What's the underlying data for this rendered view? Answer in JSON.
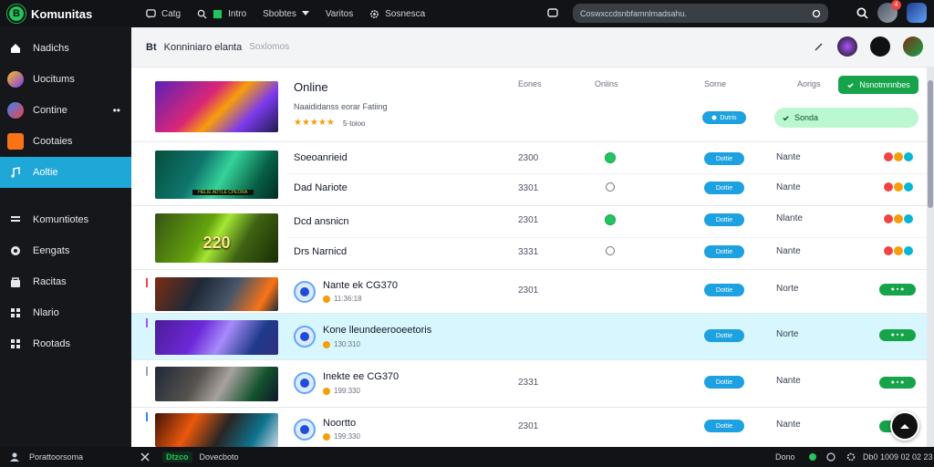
{
  "app": {
    "name": "Komunitas",
    "logo_letter": "B"
  },
  "topnav": [
    {
      "label": "Catg",
      "icon": "chat-icon"
    },
    {
      "label": "Intro",
      "icon": "flag-icon"
    },
    {
      "label": "Sbobtes",
      "icon": "menu-icon"
    },
    {
      "label": "Varitos",
      "icon": "chevron-down-icon"
    },
    {
      "label": "Sosnesca",
      "icon": "settings-icon"
    }
  ],
  "search": {
    "value": "Coswxccdsnbfamnlmadsahu."
  },
  "user": {
    "notification_count": "4"
  },
  "sidebar": {
    "items": [
      {
        "label": "Nadichs",
        "icon": "home-icon"
      },
      {
        "label": "Uocitums",
        "icon": "user-avatar-icon"
      },
      {
        "label": "Contine",
        "icon": "globe-icon",
        "more": "••"
      },
      {
        "label": "Cootaies",
        "icon": "flag-icon"
      },
      {
        "label": "Aoltie",
        "icon": "music-note-icon",
        "active": true
      }
    ],
    "items2": [
      {
        "label": "Komuntiotes",
        "icon": "list-icon"
      },
      {
        "label": "Eengats",
        "icon": "chat-icon"
      },
      {
        "label": "Racitas",
        "icon": "lock-icon"
      },
      {
        "label": "Nlario",
        "icon": "grid-icon"
      },
      {
        "label": "Rootads",
        "icon": "grid-icon"
      }
    ],
    "footer": "Porattoorsoma"
  },
  "main": {
    "header": {
      "title": "Bt",
      "subtitle": "Konniniaro elanta",
      "tail": "Soxlomos"
    },
    "columns": {
      "a": "Eones",
      "b": "Onlins",
      "c": "Sorne",
      "d": "Aorigs"
    },
    "featured": {
      "title": "Online",
      "desc": "Naaididanss eorar Fatiing",
      "stars": "★★★★★",
      "rating": "5·toioo",
      "pill": "Dutris",
      "button": "Nsnotmnnbes",
      "light_button": "Sonda"
    },
    "rows": [
      {
        "title": "Soeoanrieid",
        "num": "2300",
        "status": "Nante",
        "online": true,
        "pill": "Dottie"
      },
      {
        "title": "Dad Nariote",
        "num": "3301",
        "status": "Nante",
        "online": false,
        "pill": "Dottie"
      },
      {
        "title": "Dcd ansnicn",
        "num": "2301",
        "status": "Nlante",
        "online": true,
        "pill": "Dottie"
      },
      {
        "title": "Drs Narnicd",
        "num": "3331",
        "status": "Nante",
        "online": false,
        "pill": "Dottie"
      },
      {
        "title": "Nante ek CG370",
        "meta": "11:36:18",
        "num": "2301",
        "status": "Norte",
        "pill": "Dottie"
      },
      {
        "title": "Kone lleundeerooeetoris",
        "meta": "130:310",
        "num": "",
        "status": "Norte",
        "pill": "Dottie"
      },
      {
        "title": "Inekte ee CG370",
        "meta": "199:330",
        "num": "2331",
        "status": "Nante",
        "pill": "Dottie"
      },
      {
        "title": "Noortto",
        "meta": "199:330",
        "num": "2301",
        "status": "Nante",
        "pill": "Dottie"
      }
    ],
    "thumb_text": "220",
    "thumb_badge": "HELIE ADTLE CPEORA"
  },
  "statusbar": {
    "left": "Dtzco",
    "label": "Dovecboto",
    "right_label": "Dono",
    "right_value": "Db0 1009 02 02 23"
  },
  "colors": {
    "accent": "#1ea7d7",
    "green": "#16a34a",
    "dark": "#111316"
  }
}
